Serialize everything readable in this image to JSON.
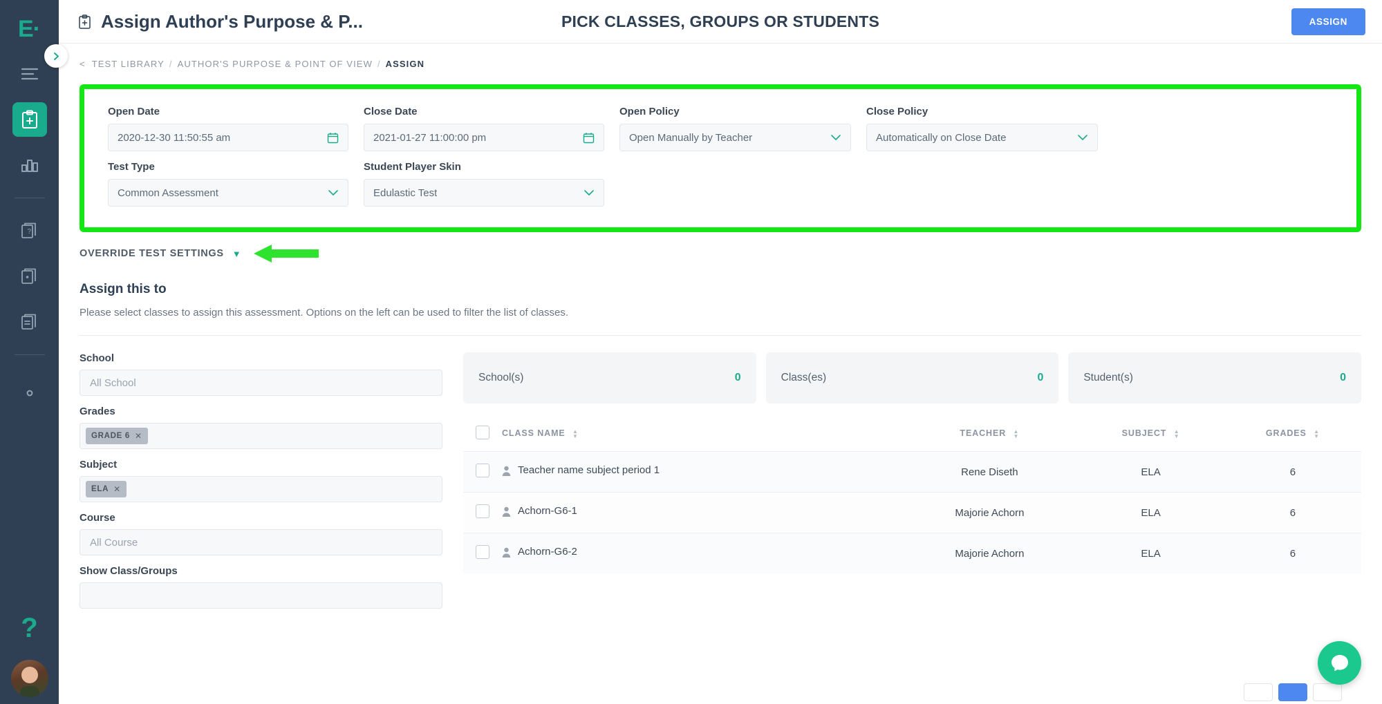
{
  "sidebar": {
    "logo": "E",
    "logo_dot": "·",
    "items": [
      {
        "name": "menu-icon",
        "label": "Menu"
      },
      {
        "name": "assignments-icon",
        "label": "Assignments"
      },
      {
        "name": "insights-icon",
        "label": "Insights"
      },
      {
        "name": "question-bank-icon",
        "label": "Question Bank"
      },
      {
        "name": "item-bank-icon",
        "label": "Item Bank"
      },
      {
        "name": "playlist-icon",
        "label": "Playlists"
      },
      {
        "name": "settings-icon",
        "label": "Settings"
      }
    ],
    "help_label": "?"
  },
  "topbar": {
    "title": "Assign Author's Purpose & P...",
    "center_title": "PICK CLASSES, GROUPS OR STUDENTS",
    "assign_label": "ASSIGN"
  },
  "breadcrumb": {
    "back": "<",
    "items": [
      "TEST LIBRARY",
      "AUTHOR'S PURPOSE & POINT OF VIEW",
      "ASSIGN"
    ],
    "separator": "/"
  },
  "settings": {
    "open_date": {
      "label": "Open Date",
      "value": "2020-12-30 11:50:55 am"
    },
    "close_date": {
      "label": "Close Date",
      "value": "2021-01-27 11:00:00 pm"
    },
    "open_policy": {
      "label": "Open Policy",
      "value": "Open Manually by Teacher"
    },
    "close_policy": {
      "label": "Close Policy",
      "value": "Automatically on Close Date"
    },
    "test_type": {
      "label": "Test Type",
      "value": "Common Assessment"
    },
    "player_skin": {
      "label": "Student Player Skin",
      "value": "Edulastic Test"
    },
    "highlight_color": "#13e714"
  },
  "override": {
    "label": "OVERRIDE TEST SETTINGS",
    "caret": "▼"
  },
  "assign": {
    "title": "Assign this to",
    "subtitle": "Please select classes to assign this assessment. Options on the left can be used to filter the list of classes."
  },
  "filters": [
    {
      "label": "School",
      "value": "All School",
      "type": "placeholder"
    },
    {
      "label": "Grades",
      "value": "GRADE 6",
      "type": "tag"
    },
    {
      "label": "Subject",
      "value": "ELA",
      "type": "tag"
    },
    {
      "label": "Course",
      "value": "All Course",
      "type": "placeholder"
    },
    {
      "label": "Show Class/Groups",
      "value": "",
      "type": "placeholder"
    }
  ],
  "stats": [
    {
      "name": "School(s)",
      "value": "0"
    },
    {
      "name": "Class(es)",
      "value": "0"
    },
    {
      "name": "Student(s)",
      "value": "0"
    }
  ],
  "table": {
    "columns": [
      "CLASS NAME",
      "TEACHER",
      "SUBJECT",
      "GRADES"
    ],
    "rows": [
      {
        "class_name": "Teacher name subject period 1",
        "teacher": "Rene Diseth",
        "subject": "ELA",
        "grades": "6"
      },
      {
        "class_name": "Achorn-G6-1",
        "teacher": "Majorie Achorn",
        "subject": "ELA",
        "grades": "6"
      },
      {
        "class_name": "Achorn-G6-2",
        "teacher": "Majorie Achorn",
        "subject": "ELA",
        "grades": "6"
      }
    ]
  },
  "colors": {
    "brand_teal": "#1aab8d",
    "assign_blue": "#4d88f0",
    "sidebar_navy": "#2f4054",
    "annotation_green": "#13e714"
  }
}
